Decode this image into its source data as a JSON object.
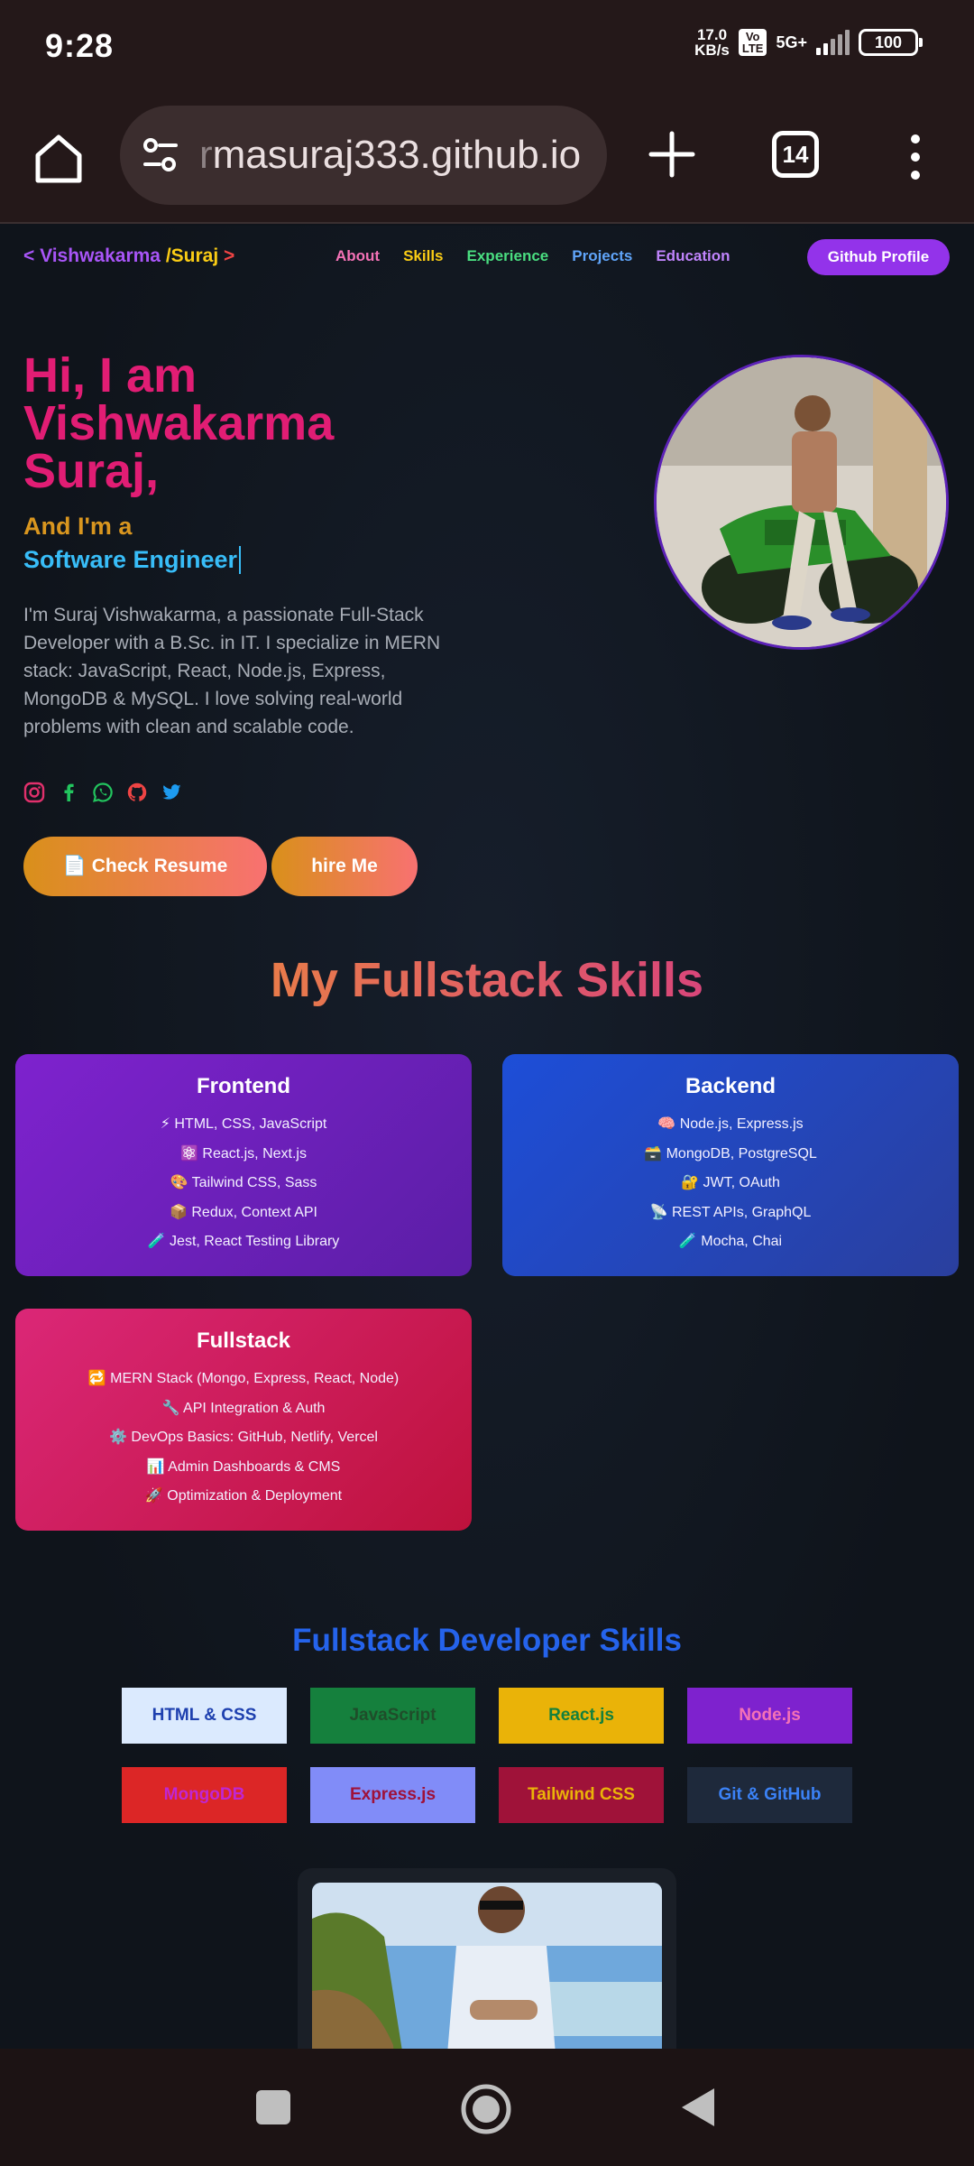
{
  "status_bar": {
    "time": "9:28",
    "speed_value": "17.0",
    "speed_unit": "KB/s",
    "volte_top": "Vo",
    "volte_bottom": "LTE",
    "network": "5G+",
    "battery": "100"
  },
  "browser": {
    "url_prefix": "r",
    "url": "masuraj333.github.io",
    "tab_count": "14"
  },
  "nav": {
    "brand_open": "<",
    "brand_name": " Vishwakarma ",
    "brand_slash": "/Suraj",
    "brand_close": " >",
    "links": [
      "About",
      "Skills",
      "Experience",
      "Projects",
      "Education"
    ],
    "github_button": "Github Profile"
  },
  "hero": {
    "title": "Hi, I am Vishwakarma Suraj,",
    "subtitle": "And I'm a",
    "role": "Software Engineer",
    "description": "I'm Suraj Vishwakarma, a passionate Full-Stack Developer with a B.Sc. in IT. I specialize in MERN stack: JavaScript, React, Node.js, Express, MongoDB & MySQL. I love solving real-world problems with clean and scalable code.",
    "resume_button": "📄 Check Resume",
    "hire_button": "hire Me"
  },
  "skills": {
    "heading": "My Fullstack Skills",
    "cards": [
      {
        "title": "Frontend",
        "items": [
          "⚡ HTML, CSS, JavaScript",
          "⚛️ React.js, Next.js",
          "🎨 Tailwind CSS, Sass",
          "📦 Redux, Context API",
          "🧪 Jest, React Testing Library"
        ]
      },
      {
        "title": "Backend",
        "items": [
          "🧠 Node.js, Express.js",
          "🗃️ MongoDB, PostgreSQL",
          "🔐 JWT, OAuth",
          "📡 REST APIs, GraphQL",
          "🧪 Mocha, Chai"
        ]
      },
      {
        "title": "Fullstack",
        "items": [
          "🔁 MERN Stack (Mongo, Express, React, Node)",
          "🔧 API Integration & Auth",
          "⚙️ DevOps Basics: GitHub, Netlify, Vercel",
          "📊 Admin Dashboards & CMS",
          "🚀 Optimization & Deployment"
        ]
      }
    ]
  },
  "dev_skills": {
    "heading": "Fullstack Developer Skills",
    "tags": [
      {
        "label": "HTML & CSS",
        "bg": "#dbeafe",
        "fg": "#1e40af"
      },
      {
        "label": "JavaScript",
        "bg": "#15803d",
        "fg": "#1f4d2a"
      },
      {
        "label": "React.js",
        "bg": "#eab308",
        "fg": "#15803d"
      },
      {
        "label": "Node.js",
        "bg": "#7e22ce",
        "fg": "#f472b6"
      },
      {
        "label": "MongoDB",
        "bg": "#dc2626",
        "fg": "#c026d3"
      },
      {
        "label": "Express.js",
        "bg": "#818cf8",
        "fg": "#9f1239"
      },
      {
        "label": "Tailwind CSS",
        "bg": "#9f1239",
        "fg": "#eab308"
      },
      {
        "label": "Git & GitHub",
        "bg": "#1e293b",
        "fg": "#3b82f6"
      }
    ]
  },
  "colors": {
    "accent_pink": "#e11d74",
    "accent_purple": "#9333ea",
    "accent_blue": "#2563eb"
  },
  "icons": [
    "home-icon",
    "tune-icon",
    "plus-icon",
    "more-vert-icon",
    "instagram-icon",
    "facebook-icon",
    "whatsapp-icon",
    "github-icon",
    "twitter-icon",
    "recents-icon",
    "home-circle-icon",
    "back-icon"
  ]
}
